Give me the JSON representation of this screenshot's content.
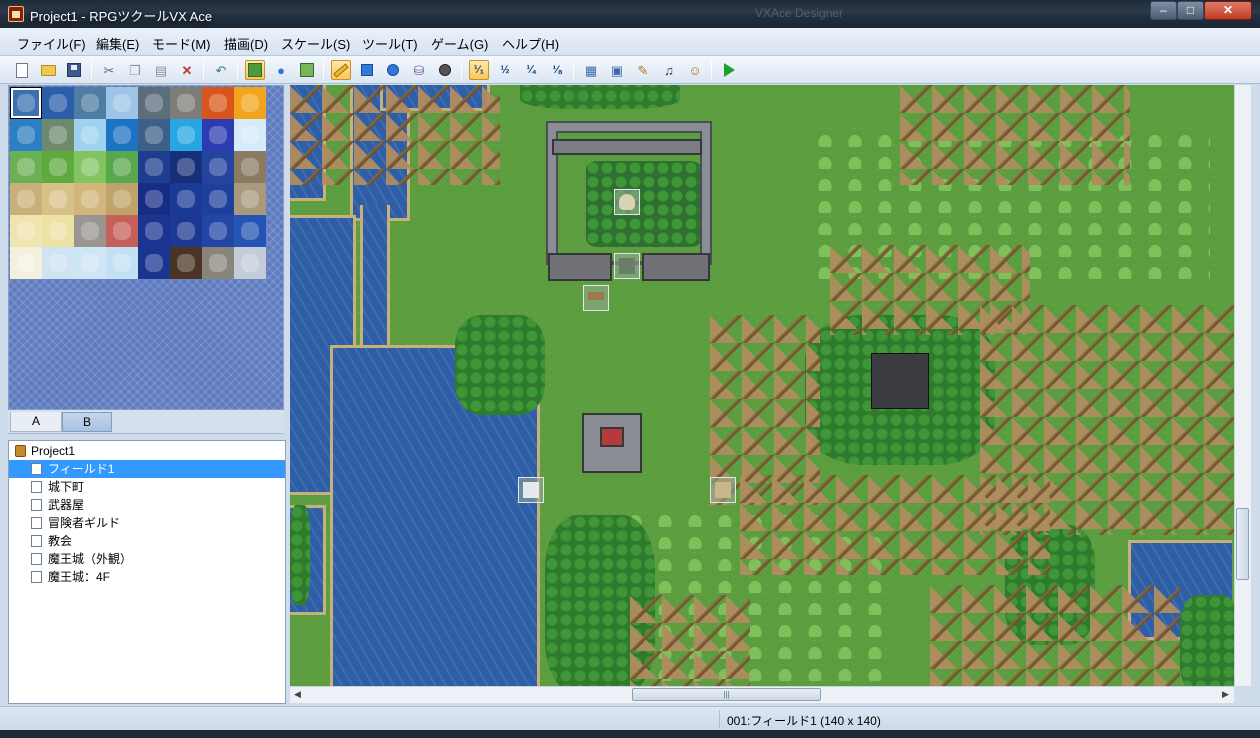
{
  "window": {
    "title": "Project1 - RPGツクールVX Ace",
    "background_title": "VXAce Designer",
    "min_label": "‒",
    "max_label": "□",
    "close_label": "✕"
  },
  "menu": [
    {
      "name": "menu-file",
      "label": "ファイル(F)"
    },
    {
      "name": "menu-edit",
      "label": "編集(E)"
    },
    {
      "name": "menu-mode",
      "label": "モード(M)"
    },
    {
      "name": "menu-draw",
      "label": "描画(D)"
    },
    {
      "name": "menu-scale",
      "label": "スケール(S)"
    },
    {
      "name": "menu-tools",
      "label": "ツール(T)"
    },
    {
      "name": "menu-game",
      "label": "ゲーム(G)"
    },
    {
      "name": "menu-help",
      "label": "ヘルプ(H)"
    }
  ],
  "toolbar": {
    "scale_1_1": "¹⁄₁",
    "scale_1_2": "½",
    "scale_1_4": "¼",
    "scale_1_8": "⅛",
    "active_tool": "pencil",
    "active_scale": "1/1"
  },
  "palette": {
    "tab_a": "A",
    "tab_b": "B",
    "active_tab": "B",
    "tile_colors": [
      "#3d70b0",
      "#2a5ea8",
      "#4e7ca3",
      "#9ec4e8",
      "#5c6d7c",
      "#7d7d78",
      "#d8561e",
      "#f2a41e",
      "#2c7fc0",
      "#6d8a6c",
      "#9fd2ee",
      "#1c73c2",
      "#3d5f88",
      "#28a6e3",
      "#2c3cb0",
      "#d6ecfa",
      "#6bb153",
      "#5faa3f",
      "#82c460",
      "#58a84e",
      "#1e3d8e",
      "#182f7a",
      "#23439c",
      "#8a7a62",
      "#c8b07a",
      "#d8c188",
      "#d2b67c",
      "#bfa36b",
      "#162c85",
      "#1a3a95",
      "#1f3f9c",
      "#a89a7a",
      "#f0e4b0",
      "#ece2a4",
      "#9a9590",
      "#c46058",
      "#1b3490",
      "#1c3892",
      "#2146a4",
      "#2454b4",
      "#f4f0e0",
      "#cfe3f2",
      "#cfe6f6",
      "#c3e0f4",
      "#1a3590",
      "#4a3426",
      "#8a857c",
      "#c4ccd8"
    ]
  },
  "tree": {
    "root": "Project1",
    "selected_index": 0,
    "maps": [
      "フィールド1",
      "城下町",
      "武器屋",
      "冒険者ギルド",
      "教会",
      "魔王城（外観）",
      "魔王城：4F"
    ]
  },
  "status": {
    "map_info": "001:フィールド1 (140 x 140)"
  },
  "scroll": {
    "hscroll_grip": "|||"
  },
  "colors": {
    "selection": "#3399ff",
    "grass": "#5c9e3f",
    "water": "#2e5fa6",
    "sand": "#c8b07a"
  }
}
